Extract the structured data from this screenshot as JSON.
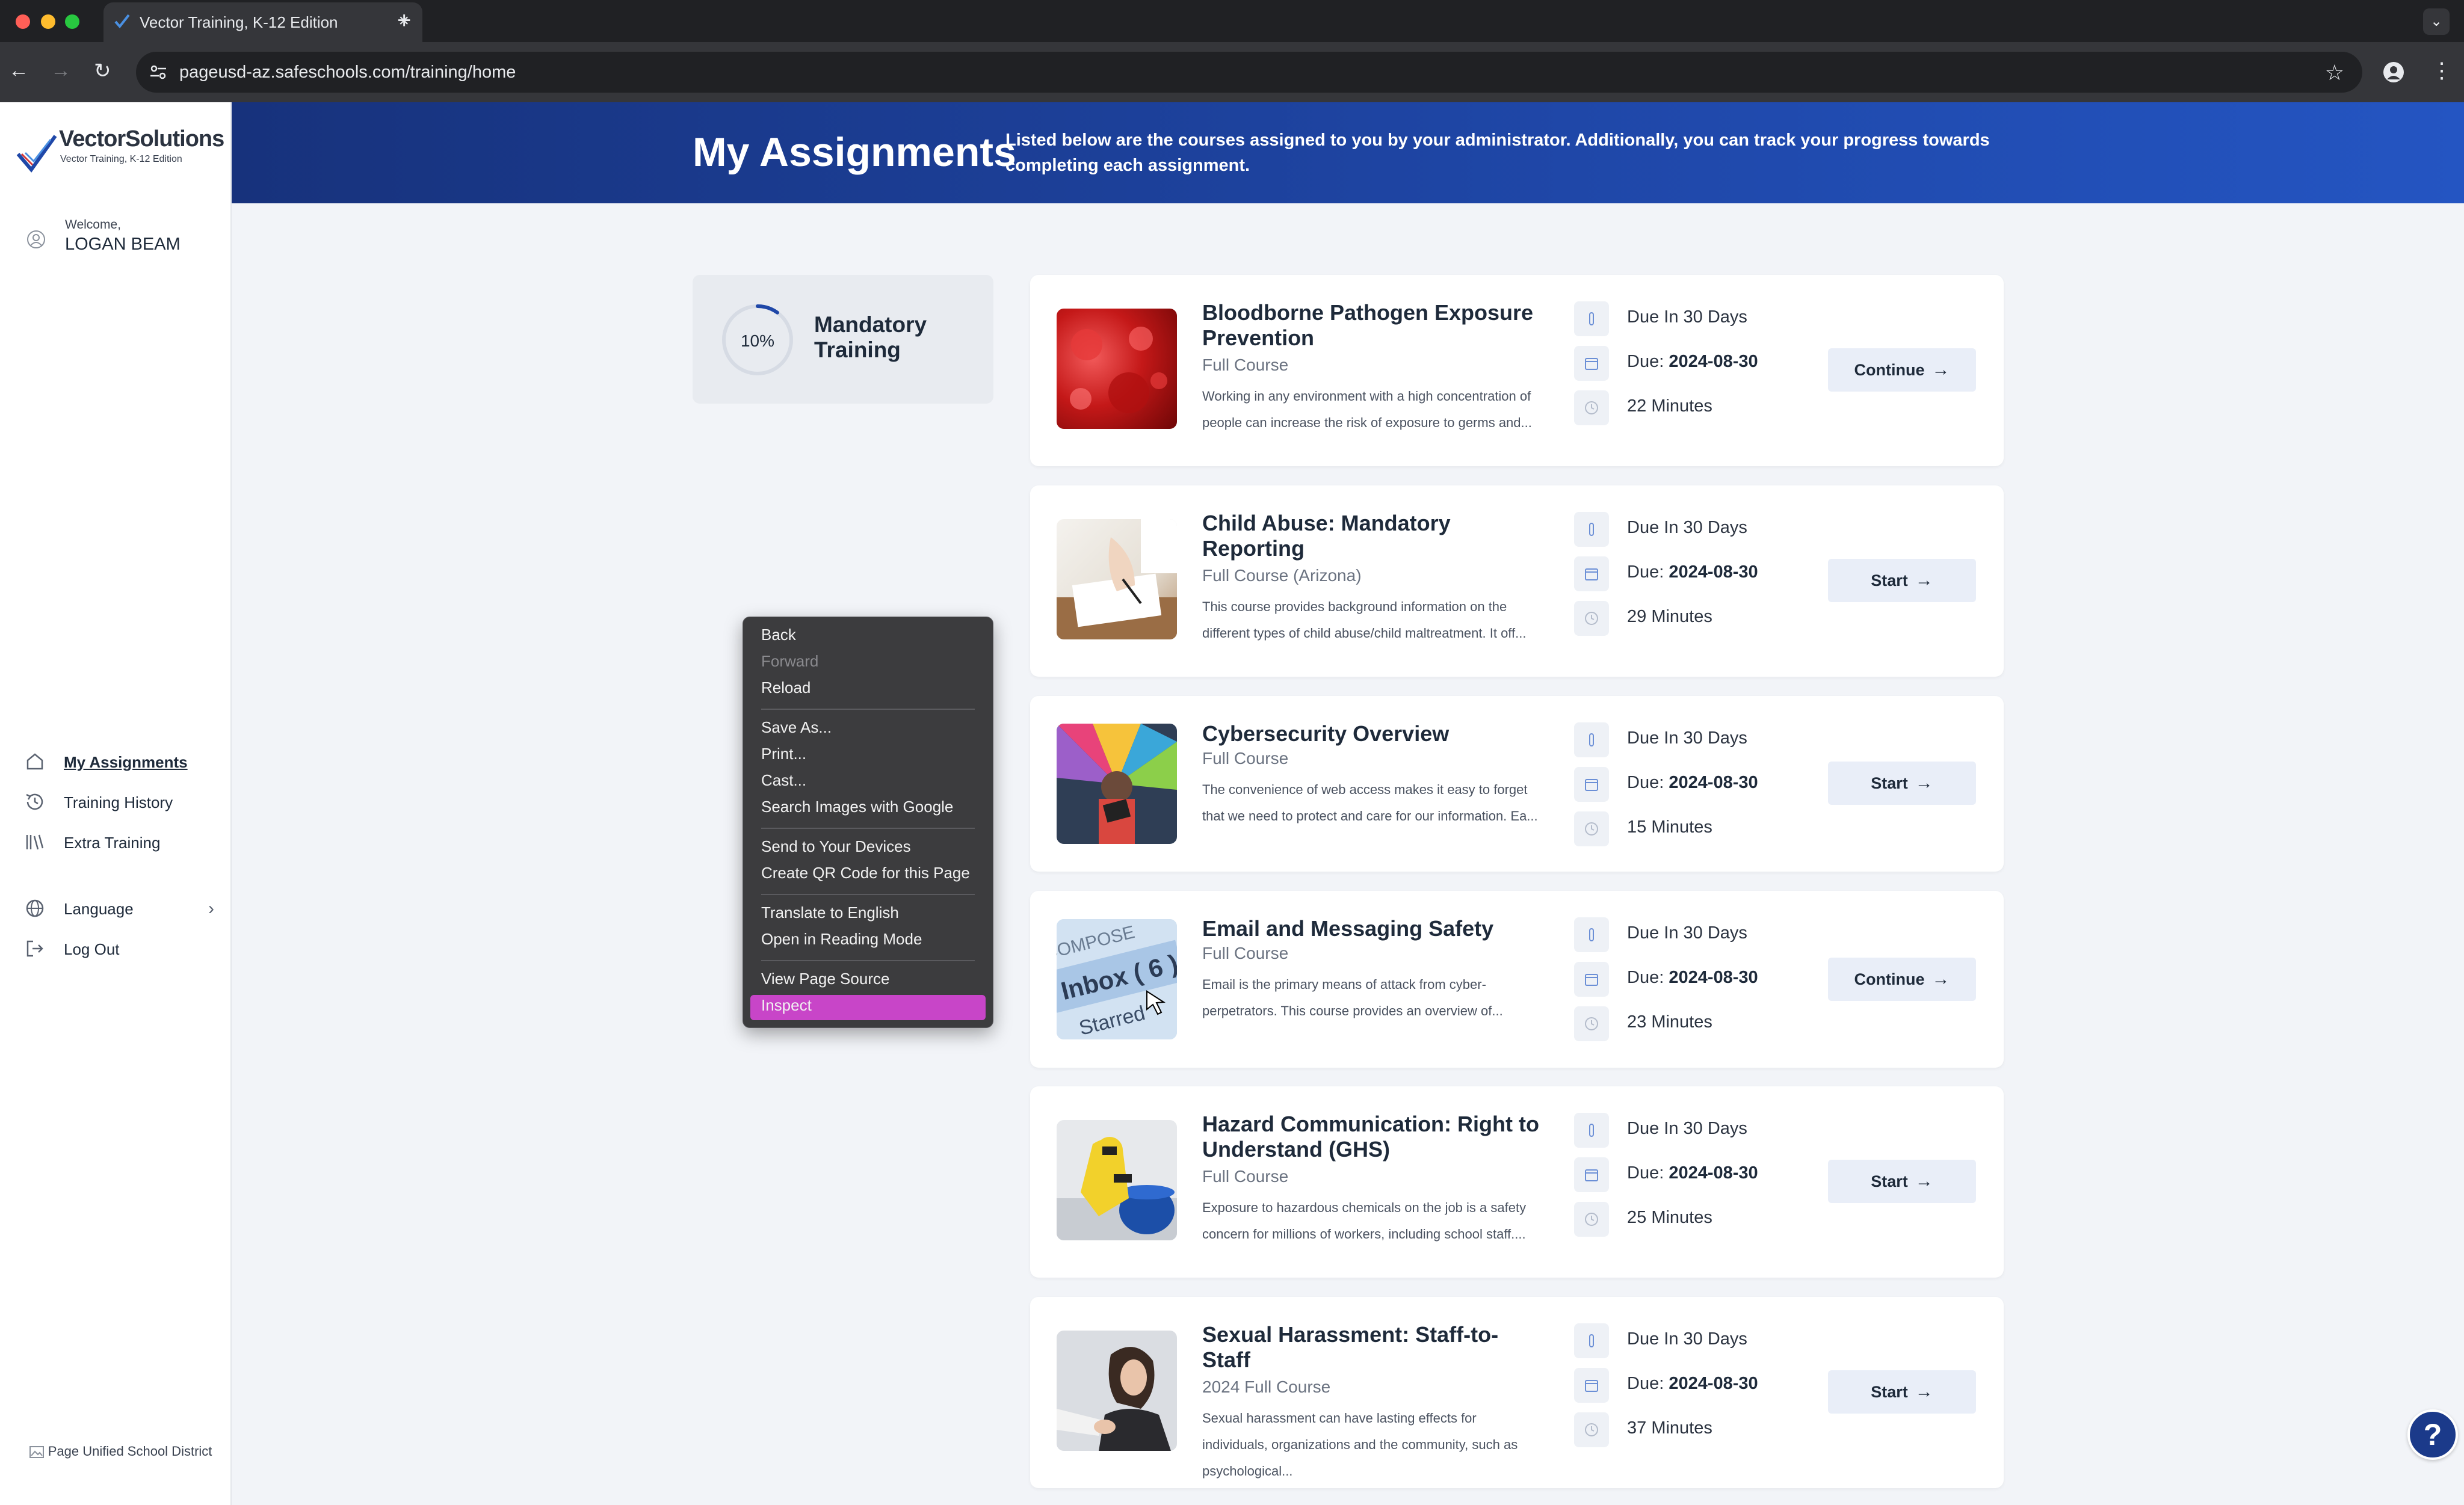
{
  "browser": {
    "tab_title": "Vector Training, K-12 Edition",
    "url": "pageusd-az.safeschools.com/training/home",
    "new_tab_symbol": "+"
  },
  "sidebar": {
    "logo_text": "VectorSolutions",
    "logo_subtext": "Vector Training, K-12 Edition",
    "welcome_label": "Welcome,",
    "user_name": "LOGAN BEAM",
    "nav": [
      {
        "label": "My Assignments",
        "icon": "home-icon"
      },
      {
        "label": "Training History",
        "icon": "history-icon"
      },
      {
        "label": "Extra Training",
        "icon": "library-icon"
      }
    ],
    "language_label": "Language",
    "logout_label": "Log Out",
    "district_logo_alt": "Page Unified School District"
  },
  "header": {
    "title": "My Assignments",
    "description": "Listed below are the courses assigned to you by your administrator. Additionally, you can track your progress towards completing each assignment."
  },
  "mandatory": {
    "progress_label": "10%",
    "progress_value": 0.1,
    "title": "Mandatory Training"
  },
  "courses": [
    {
      "title": "Bloodborne Pathogen Exposure Prevention",
      "type": "Full Course",
      "desc": "Working in any environment with a high concentration of people can increase the risk of exposure to germs and...",
      "due_in": "Due In 30 Days",
      "due_label": "Due:",
      "due_date": "2024-08-30",
      "duration": "22 Minutes",
      "button": "Continue"
    },
    {
      "title": "Child Abuse: Mandatory Reporting",
      "type": "Full Course (Arizona)",
      "desc": "This course provides background information on the different types of child abuse/child maltreatment. It off...",
      "due_in": "Due In 30 Days",
      "due_label": "Due:",
      "due_date": "2024-08-30",
      "duration": "29 Minutes",
      "button": "Start"
    },
    {
      "title": "Cybersecurity Overview",
      "type": "Full Course",
      "desc": "The convenience of web access makes it easy to forget that we need to protect and care for our information. Ea...",
      "due_in": "Due In 30 Days",
      "due_label": "Due:",
      "due_date": "2024-08-30",
      "duration": "15 Minutes",
      "button": "Start"
    },
    {
      "title": "Email and Messaging Safety",
      "type": "Full Course",
      "desc": "Email is the primary means of attack from cyber-perpetrators. This course provides an overview of...",
      "due_in": "Due In 30 Days",
      "due_label": "Due:",
      "due_date": "2024-08-30",
      "duration": "23 Minutes",
      "button": "Continue"
    },
    {
      "title": "Hazard Communication: Right to Understand (GHS)",
      "type": "Full Course",
      "desc": "Exposure to hazardous chemicals on the job is a safety concern for millions of workers, including school staff....",
      "due_in": "Due In 30 Days",
      "due_label": "Due:",
      "due_date": "2024-08-30",
      "duration": "25 Minutes",
      "button": "Start"
    },
    {
      "title": "Sexual Harassment: Staff-to-Staff",
      "type": "2024 Full Course",
      "desc": "Sexual harassment can have lasting effects for individuals, organizations and the community, such as psychological...",
      "due_in": "Due In 30 Days",
      "due_label": "Due:",
      "due_date": "2024-08-30",
      "duration": "37 Minutes",
      "button": "Start"
    }
  ],
  "thumbnail_texts": {
    "inbox": "Inbox ( 6 )",
    "compose": "COMPOSE",
    "starred": "Starred"
  },
  "context_menu": {
    "items": [
      "Back",
      "Forward",
      "Reload",
      "Save As...",
      "Print...",
      "Cast...",
      "Search Images with Google",
      "Send to Your Devices",
      "Create QR Code for this Page",
      "Translate to English",
      "Open in Reading Mode",
      "View Page Source",
      "Inspect"
    ],
    "disabled": [
      "Forward"
    ],
    "highlighted": "Inspect"
  },
  "help_label": "?",
  "colors": {
    "header": "#1f47a8",
    "menu_highlight": "#c845c8",
    "accent": "#1b3a8a"
  }
}
